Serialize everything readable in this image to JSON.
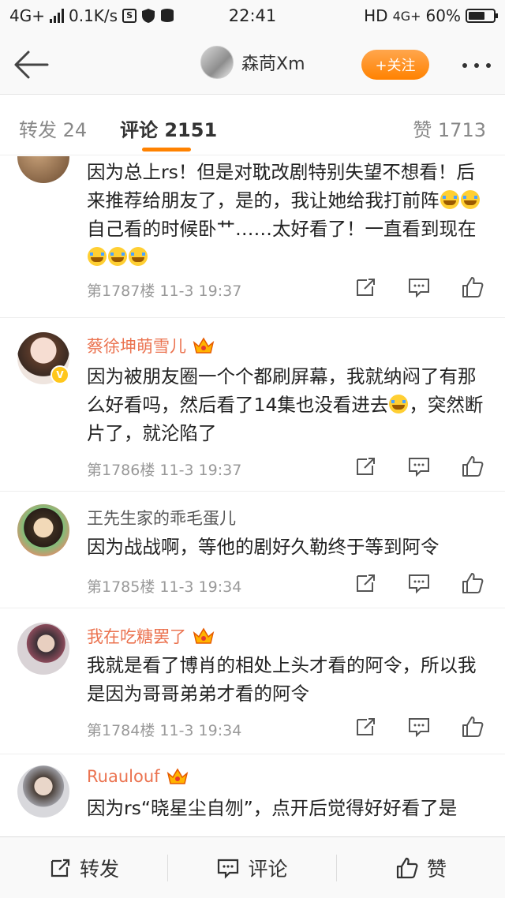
{
  "status_bar": {
    "network_left": "4G+",
    "speed": "0.1K/s",
    "time": "22:41",
    "network_right": "HD",
    "network_right_type": "4G+",
    "battery": "60%"
  },
  "nav": {
    "username": "森苘Xm",
    "follow_label": "+关注"
  },
  "tabs": {
    "repost": "转发 24",
    "comments": "评论 2151",
    "likes": "赞 1713"
  },
  "comments": [
    {
      "name": "",
      "text": "因为总上rs！但是对耽改剧特别失望不想看！后来推荐给朋友了，是的，我让她给我打前阵",
      "text_mid": "自己看的时候卧艹……太好看了！一直看到现在",
      "meta": "第1787楼  11-3 19:37"
    },
    {
      "name": "蔡徐坤萌雪儿",
      "text": "因为被朋友圈一个个都刷屏幕，我就纳闷了有那么好看吗，然后看了14集也没看进去",
      "text_end": "，突然断片了，就沦陷了",
      "meta": "第1786楼  11-3 19:37"
    },
    {
      "name": "王先生家的乖毛蛋儿",
      "text": "因为战战啊，等他的剧好久勒终于等到阿令",
      "meta": "第1785楼  11-3 19:34"
    },
    {
      "name": "我在吃糖罢了",
      "text": "我就是看了博肖的相处上头才看的阿令，所以我是因为哥哥弟弟才看的阿令",
      "meta": "第1784楼  11-3 19:34"
    },
    {
      "name": "Ruaulouf",
      "text": "因为rs“晓星尘自刎”，点开后觉得好好看了是",
      "meta": ""
    }
  ],
  "bottom_bar": {
    "repost": "转发",
    "comment": "评论",
    "like": "赞"
  },
  "colors": {
    "accent": "#ff8200",
    "vip_name": "#eb7350",
    "meta_text": "#999999"
  }
}
